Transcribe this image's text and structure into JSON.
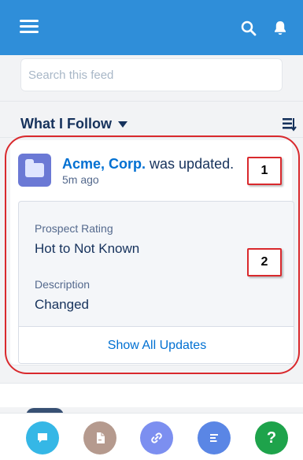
{
  "header": {
    "background": "#2f8ed9",
    "icons": [
      "hamburger-menu-icon",
      "search-icon",
      "bell-icon"
    ]
  },
  "search": {
    "placeholder": "Search this feed"
  },
  "filter": {
    "label": "What I Follow",
    "icon": "chevron-down-icon",
    "sort_icon": "sort-icon"
  },
  "feed_item": {
    "entity": "Acme, Corp.",
    "action": " was updated.",
    "time": "5m ago",
    "avatar_icon": "folder-icon",
    "annotations": [
      "1",
      "2"
    ],
    "changes": [
      {
        "label": "Prospect Rating",
        "value": "Hot to Not Known"
      },
      {
        "label": "Description",
        "value": "Changed"
      }
    ],
    "show_all": "Show All Updates"
  },
  "actions": [
    {
      "icon": "post-icon",
      "color": "#35b7e6"
    },
    {
      "icon": "file-icon",
      "color": "#b59a8e"
    },
    {
      "icon": "link-icon",
      "color": "#7c8ff0"
    },
    {
      "icon": "poll-icon",
      "color": "#5a86e5"
    },
    {
      "icon": "question-icon",
      "label": "?",
      "color": "#1ea34b"
    }
  ],
  "colors": {
    "accent": "#0070d2",
    "annotation": "#d9292d"
  }
}
